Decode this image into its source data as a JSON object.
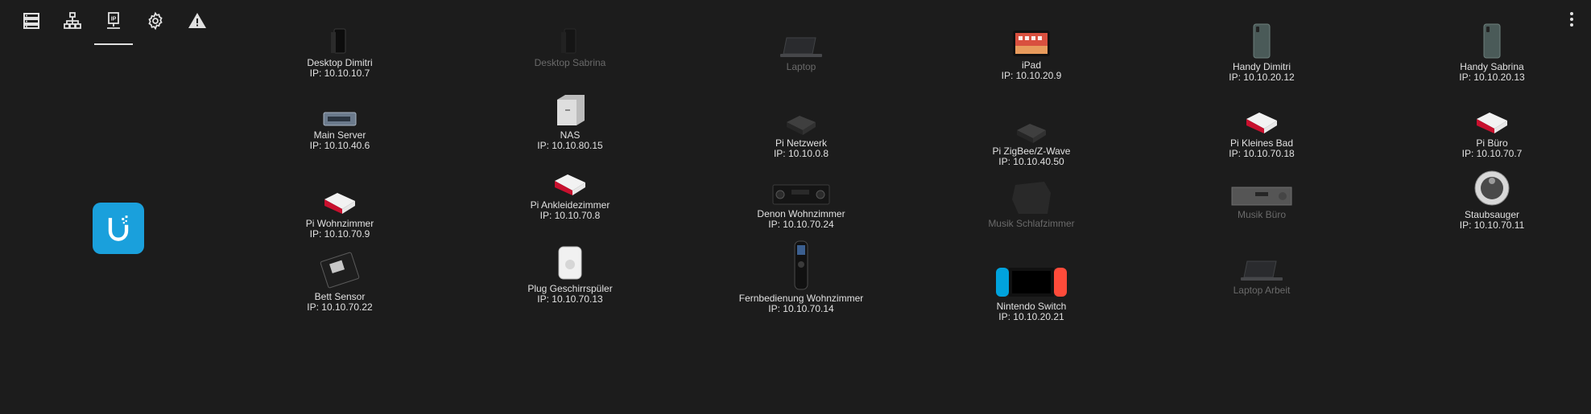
{
  "toolbar": {
    "tabs": [
      {
        "icon": "server-list-icon",
        "label": "Devices"
      },
      {
        "icon": "network-icon",
        "label": "Network"
      },
      {
        "icon": "ip-network-icon",
        "label": "IP Addresses"
      },
      {
        "icon": "gear-icon",
        "label": "Settings"
      },
      {
        "icon": "warning-icon",
        "label": "Alerts"
      }
    ],
    "active_index": 2,
    "menu_icon": "dots-vertical-icon"
  },
  "logo": {
    "icon": "unifi-logo-icon",
    "color": "#1aa0dc"
  },
  "devices": [
    {
      "name": "Desktop Dimitri",
      "ip": "IP: 10.10.10.7",
      "online": true,
      "icon": "desktop-icon"
    },
    {
      "name": "Desktop Sabrina",
      "ip": "",
      "online": false,
      "icon": "desktop-icon"
    },
    {
      "name": "Laptop",
      "ip": "",
      "online": false,
      "icon": "laptop-icon"
    },
    {
      "name": "iPad",
      "ip": "IP: 10.10.20.9",
      "online": true,
      "icon": "tablet-icon"
    },
    {
      "name": "Handy Dimitri",
      "ip": "IP: 10.10.20.12",
      "online": true,
      "icon": "phone-icon"
    },
    {
      "name": "Handy Sabrina",
      "ip": "IP: 10.10.20.13",
      "online": true,
      "icon": "phone-icon"
    },
    {
      "name": "Main Server",
      "ip": "IP: 10.10.40.6",
      "online": true,
      "icon": "server-icon"
    },
    {
      "name": "NAS",
      "ip": "IP: 10.10.80.15",
      "online": true,
      "icon": "nas-icon"
    },
    {
      "name": "Pi Netzwerk",
      "ip": "IP: 10.10.0.8",
      "online": true,
      "icon": "pi-case-dark-icon"
    },
    {
      "name": "Pi ZigBee/Z-Wave",
      "ip": "IP: 10.10.40.50",
      "online": true,
      "icon": "pi-case-dark-icon"
    },
    {
      "name": "Pi Kleines Bad",
      "ip": "IP: 10.10.70.18",
      "online": true,
      "icon": "pi-case-red-icon"
    },
    {
      "name": "Pi Büro",
      "ip": "IP: 10.10.70.7",
      "online": true,
      "icon": "pi-case-red-icon"
    },
    {
      "name": "Pi Wohnzimmer",
      "ip": "IP: 10.10.70.9",
      "online": true,
      "icon": "pi-case-red-icon"
    },
    {
      "name": "Pi Ankleidezimmer",
      "ip": "IP: 10.10.70.8",
      "online": true,
      "icon": "pi-case-red-icon"
    },
    {
      "name": "Denon Wohnzimmer",
      "ip": "IP: 10.10.70.24",
      "online": true,
      "icon": "av-receiver-icon"
    },
    {
      "name": "Musik Schlafzimmer",
      "ip": "",
      "online": false,
      "icon": "speaker-icon"
    },
    {
      "name": "Musik Büro",
      "ip": "",
      "online": false,
      "icon": "amplifier-icon"
    },
    {
      "name": "Staubsauger",
      "ip": "IP: 10.10.70.11",
      "online": true,
      "icon": "robot-vacuum-icon"
    },
    {
      "name": "Bett Sensor",
      "ip": "IP: 10.10.70.22",
      "online": true,
      "icon": "esp-board-icon"
    },
    {
      "name": "Plug Geschirrspüler",
      "ip": "IP: 10.10.70.13",
      "online": true,
      "icon": "smart-plug-icon"
    },
    {
      "name": "Fernbedienung Wohnzimmer",
      "ip": "IP: 10.10.70.14",
      "online": true,
      "icon": "remote-icon"
    },
    {
      "name": "Nintendo Switch",
      "ip": "IP: 10.10.20.21",
      "online": true,
      "icon": "game-console-icon"
    },
    {
      "name": "Laptop Arbeit",
      "ip": "",
      "online": false,
      "icon": "laptop-icon"
    }
  ]
}
